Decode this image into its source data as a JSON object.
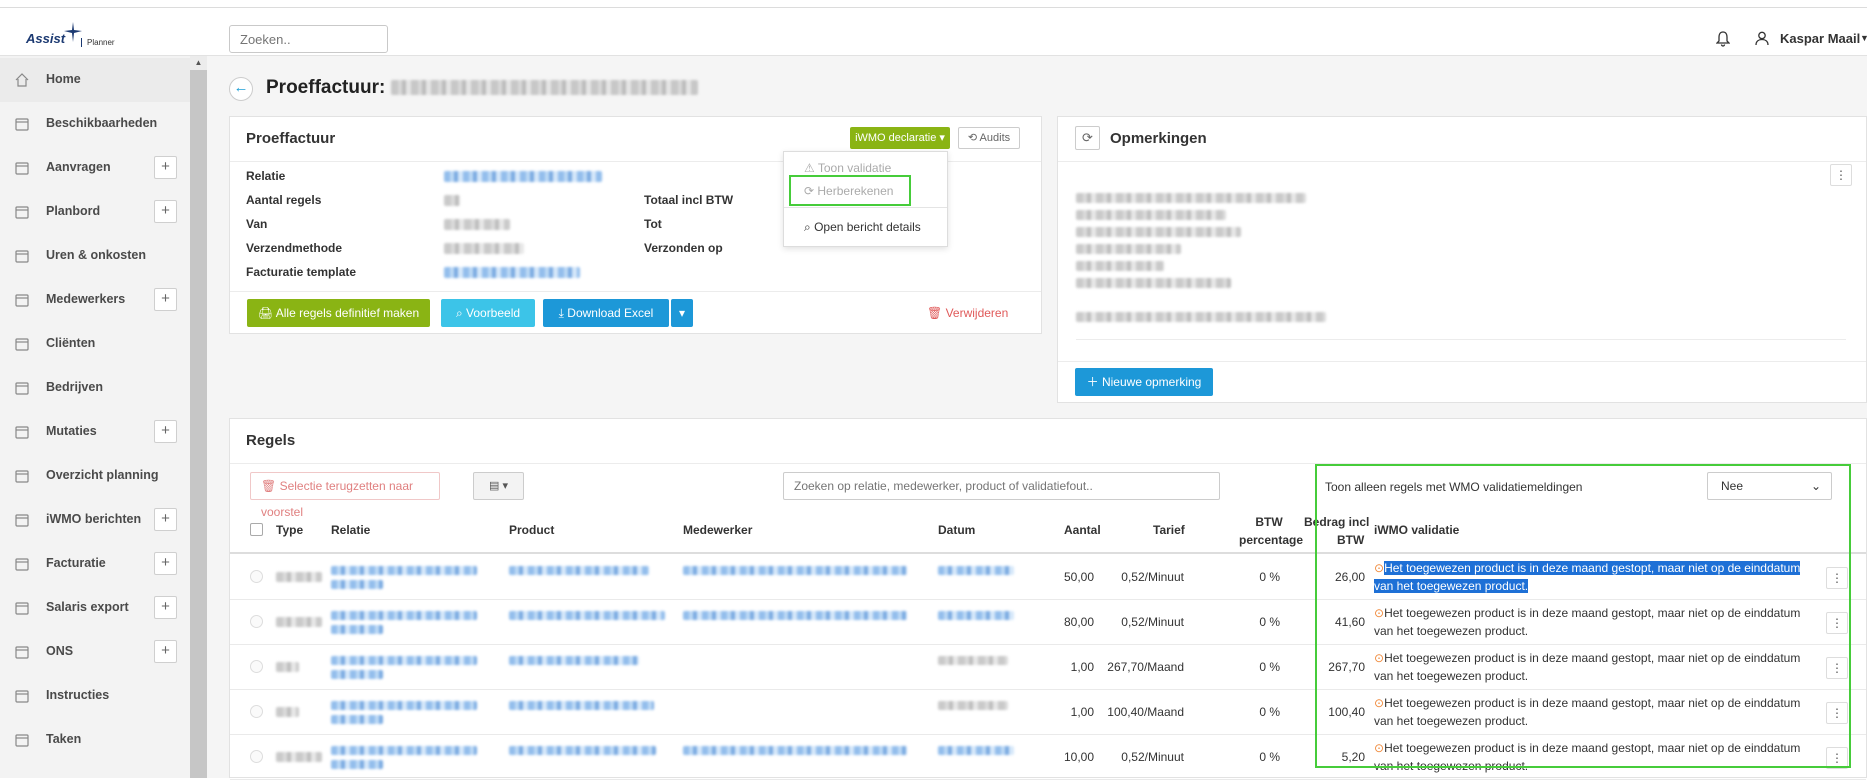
{
  "app": {
    "logo_text": "Assist",
    "logo_sub": "Planner"
  },
  "topbar": {
    "search_placeholder": "Zoeken..",
    "user_name": "Kaspar Maail"
  },
  "sidebar": {
    "items": [
      {
        "label": "Home",
        "icon": "home-icon",
        "plus": false
      },
      {
        "label": "Beschikbaarheden",
        "icon": "calendar-check-icon",
        "plus": false
      },
      {
        "label": "Aanvragen",
        "icon": "calendar-plus-icon",
        "plus": true
      },
      {
        "label": "Planbord",
        "icon": "clipboard-icon",
        "plus": true
      },
      {
        "label": "Uren & onkosten",
        "icon": "clock-icon",
        "plus": false
      },
      {
        "label": "Medewerkers",
        "icon": "users-icon",
        "plus": true
      },
      {
        "label": "Cliënten",
        "icon": "client-icon",
        "plus": false
      },
      {
        "label": "Bedrijven",
        "icon": "building-icon",
        "plus": false
      },
      {
        "label": "Mutaties",
        "icon": "arrows-icon",
        "plus": true
      },
      {
        "label": "Overzicht planning",
        "icon": "calendar-grid-icon",
        "plus": false
      },
      {
        "label": "iWMO berichten",
        "icon": "inbox-icon",
        "plus": true
      },
      {
        "label": "Facturatie",
        "icon": "invoice-icon",
        "plus": true
      },
      {
        "label": "Salaris export",
        "icon": "export-icon",
        "plus": true
      },
      {
        "label": "ONS",
        "icon": "chart-icon",
        "plus": true
      },
      {
        "label": "Instructies",
        "icon": "video-icon",
        "plus": false
      },
      {
        "label": "Taken",
        "icon": "tasks-icon",
        "plus": false
      }
    ]
  },
  "page": {
    "title": "Proeffactuur:"
  },
  "invoice": {
    "header": "Proeffactuur",
    "iwmo_button": "iWMO declaratie",
    "audits_button": "Audits",
    "labels": {
      "relatie": "Relatie",
      "aantal_regels": "Aantal regels",
      "van": "Van",
      "verzendmethode": "Verzendmethode",
      "facturatie_template": "Facturatie template",
      "totaal": "Totaal incl BTW",
      "tot": "Tot",
      "verzonden_op": "Verzonden op"
    },
    "buttons": {
      "definitief": "Alle regels definitief maken",
      "voorbeeld": "Voorbeeld",
      "excel": "Download Excel",
      "verwijderen": "Verwijderen"
    }
  },
  "dropdown": {
    "items": [
      "Toon validatie",
      "Herberekenen",
      "Open bericht details"
    ]
  },
  "remarks": {
    "header": "Opmerkingen",
    "new_button": "Nieuwe opmerking"
  },
  "rules": {
    "header": "Regels",
    "reset_button": "Selectie terugzetten naar voorstel",
    "search_placeholder": "Zoeken op relatie, medewerker, product of validatiefout..",
    "filter_label": "Toon alleen regels met WMO validatiemeldingen",
    "filter_value": "Nee",
    "columns": {
      "type": "Type",
      "relatie": "Relatie",
      "product": "Product",
      "medewerker": "Medewerker",
      "datum": "Datum",
      "aantal": "Aantal",
      "tarief": "Tarief",
      "btw1": "BTW",
      "btw2": "percentage",
      "bedrag1": "Bedrag incl",
      "bedrag2": "BTW",
      "validatie": "iWMO validatie"
    },
    "rows": [
      {
        "aantal": "50,00",
        "tarief": "0,52/Minuut",
        "btw": "0 %",
        "bedrag": "26,00",
        "validatie": "Het toegewezen product is in deze maand gestopt, maar niet op de einddatum van het toegewezen product."
      },
      {
        "aantal": "80,00",
        "tarief": "0,52/Minuut",
        "btw": "0 %",
        "bedrag": "41,60",
        "validatie": "Het toegewezen product is in deze maand gestopt, maar niet op de einddatum van het toegewezen product."
      },
      {
        "aantal": "1,00",
        "tarief": "267,70/Maand",
        "btw": "0 %",
        "bedrag": "267,70",
        "validatie": "Het toegewezen product is in deze maand gestopt, maar niet op de einddatum van het toegewezen product."
      },
      {
        "aantal": "1,00",
        "tarief": "100,40/Maand",
        "btw": "0 %",
        "bedrag": "100,40",
        "validatie": "Het toegewezen product is in deze maand gestopt, maar niet op de einddatum van het toegewezen product."
      },
      {
        "aantal": "10,00",
        "tarief": "0,52/Minuut",
        "btw": "0 %",
        "bedrag": "5,20",
        "validatie": "Het toegewezen product is in deze maand gestopt, maar niet op de einddatum van het toegewezen product."
      }
    ]
  },
  "colors": {
    "green": "#8ab414",
    "cyan": "#3cc4e8",
    "blue": "#1d98d8",
    "red": "#e05a5a",
    "highlight": "#46cc3a"
  }
}
